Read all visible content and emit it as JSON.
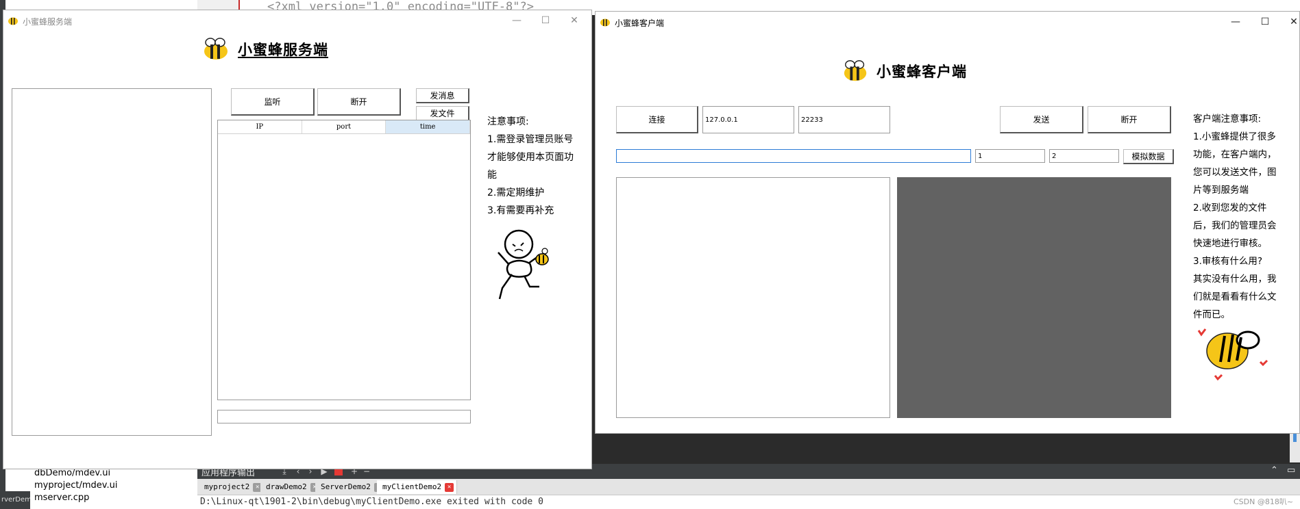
{
  "ide": {
    "code_line": "<?xml version=\"1.0\" encoding=\"UTF-8\"?>",
    "project_items": [
      "dbDemo/mdev.ui",
      "myproject/mdev.ui",
      "mserver.cpp"
    ],
    "side_label": "rverDemo",
    "output_title": "应用程序输出",
    "tabs": [
      {
        "label": "myproject2"
      },
      {
        "label": "drawDemo2"
      },
      {
        "label": "ServerDemo2"
      },
      {
        "label": "myClientDemo2"
      }
    ],
    "console_text": "D:\\Linux-qt\\1901-2\\bin\\debug\\myClientDemo.exe exited with code 0",
    "watermark": "CSDN @818叭~"
  },
  "server": {
    "window_title": "小蜜蜂服务端",
    "heading": "小蜜蜂服务端",
    "buttons": {
      "listen": "监听",
      "disconnect": "断开",
      "send_msg": "发消息",
      "send_file": "发文件"
    },
    "table_headers": [
      "IP",
      "port",
      "time"
    ],
    "notes": [
      "注意事项:",
      "1.需登录管理员账号",
      "才能够使用本页面功",
      "能",
      "2.需定期维护",
      "3.有需要再补充"
    ]
  },
  "client": {
    "window_title": "小蜜蜂客户端",
    "heading": "小蜜蜂客户端",
    "buttons": {
      "connect": "连接",
      "send": "发送",
      "disconnect": "断开",
      "simulate": "模拟数据"
    },
    "ip_value": "127.0.0.1",
    "port_value": "22233",
    "message_value": "",
    "field1_value": "1",
    "field2_value": "2",
    "notes": [
      "客户端注意事项:",
      "1.小蜜蜂提供了很多",
      "功能，在客户端内，",
      "您可以发送文件，图",
      "片等到服务端",
      "2.收到您发的文件",
      "后，我们的管理员会",
      "快速地进行审核。",
      "3.审核有什么用?",
      "其实没有什么用，我",
      "们就是看看有什么文",
      "件而已。"
    ]
  },
  "colors": {
    "bee_yellow": "#f5c518",
    "heart_red": "#e53935",
    "image_panel_gray": "#626262",
    "selected_header": "#d9e9f7"
  }
}
